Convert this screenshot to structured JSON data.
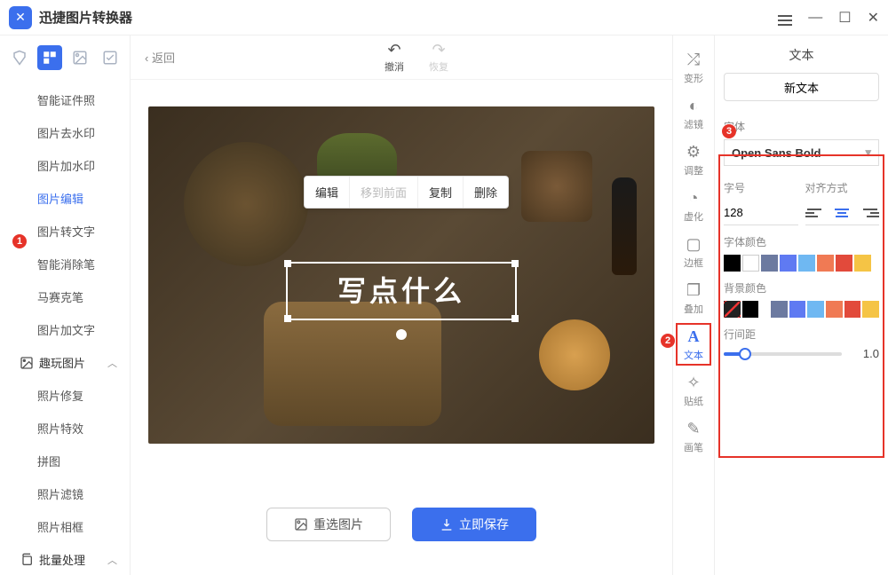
{
  "app": {
    "title": "迅捷图片转换器"
  },
  "win": {
    "menu": "≡",
    "min": "—",
    "max": "☐",
    "close": "✕"
  },
  "topTabs": {
    "shield": "⯐",
    "format": "▦",
    "image": "🖼",
    "check": "☑"
  },
  "sidebar": {
    "items": [
      "智能证件照",
      "图片去水印",
      "图片加水印",
      "图片编辑",
      "图片转文字",
      "智能消除笔",
      "马赛克笔",
      "图片加文字"
    ],
    "group1": "趣玩图片",
    "g1items": [
      "照片修复",
      "照片特效",
      "拼图",
      "照片滤镜",
      "照片相框"
    ],
    "group2": "批量处理"
  },
  "center": {
    "back": "返回",
    "undo": "撤消",
    "redo": "恢复",
    "ctx": {
      "edit": "编辑",
      "front": "移到前面",
      "copy": "复制",
      "del": "删除"
    },
    "placeholder_text": "写点什么",
    "reselect": "重选图片",
    "save": "立即保存"
  },
  "rail": {
    "items": [
      {
        "icon": "⤮",
        "label": "变形"
      },
      {
        "icon": "◐",
        "label": "滤镜"
      },
      {
        "icon": "⚙",
        "label": "调整"
      },
      {
        "icon": "◔",
        "label": "虚化"
      },
      {
        "icon": "▢",
        "label": "边框"
      },
      {
        "icon": "❐",
        "label": "叠加"
      },
      {
        "icon": "A",
        "label": "文本"
      },
      {
        "icon": "✧",
        "label": "贴纸"
      },
      {
        "icon": "✎",
        "label": "画笔"
      }
    ]
  },
  "panel": {
    "title": "文本",
    "newText": "新文本",
    "fontLabel": "字体",
    "fontValue": "Open Sans Bold",
    "sizeLabel": "字号",
    "sizeValue": "128",
    "alignLabel": "对齐方式",
    "fgLabel": "字体颜色",
    "fgColors": [
      "#000000",
      "#ffffff",
      "#6c7aa0",
      "#5f7af2",
      "#6fb8f2",
      "#f07a54",
      "#e24a3b",
      "#f5c445"
    ],
    "bgLabel": "背景颜色",
    "bgColors": [
      "none",
      "#000000",
      "gap",
      "#6c7aa0",
      "#5f7af2",
      "#6fb8f2",
      "#f07a54",
      "#e24a3b",
      "#f5c445"
    ],
    "lineLabel": "行间距",
    "lineValue": "1.0"
  },
  "callouts": {
    "one": "1",
    "two": "2",
    "three": "3"
  }
}
